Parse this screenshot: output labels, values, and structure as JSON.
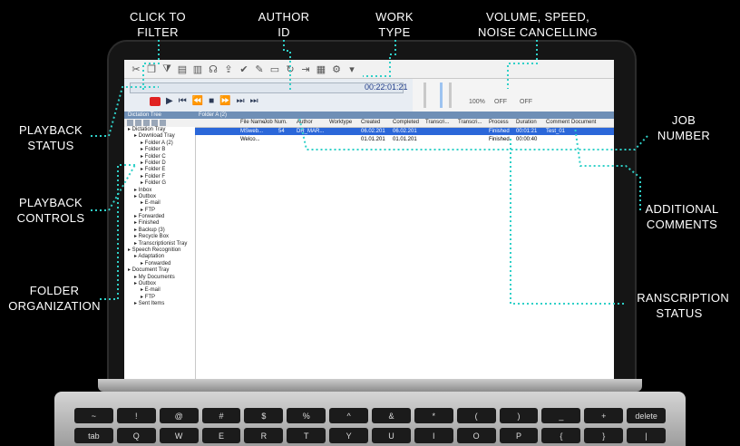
{
  "callouts": {
    "click_to_filter": "CLICK TO\nFILTER",
    "author_id": "AUTHOR\nID",
    "work_type": "WORK\nTYPE",
    "volume_speed": "VOLUME, SPEED,\nNOISE CANCELLING",
    "playback_status": "PLAYBACK\nSTATUS",
    "job_number": "JOB\nNUMBER",
    "playback_controls": "PLAYBACK\nCONTROLS",
    "additional_comments": "ADDITIONAL\nCOMMENTS",
    "folder_organization": "FOLDER\nORGANIZATION",
    "transcription_status": "TRANSCRIPTION\nSTATUS"
  },
  "app": {
    "time_display": "00:22:01:21",
    "tree_header": "Dictation Tree",
    "list_header": "Folder A (2)",
    "settings": {
      "volume_label": "100%",
      "speed_label": "OFF",
      "noise_label": "OFF"
    },
    "tree_items": [
      "Dictation Tray",
      "Download Tray",
      "Folder A (2)",
      "Folder B",
      "Folder C",
      "Folder D",
      "Folder E",
      "Folder F",
      "Folder G",
      "Inbox",
      "Outbox",
      "E-mail",
      "FTP",
      "Forwarded",
      "Finished",
      "Backup (3)",
      "Recycle Box",
      "Transcriptionist Tray",
      "Speech Recognition",
      "Adaptation",
      "Forwarded",
      "Document Tray",
      "My Documents",
      "Outbox",
      "E-mail",
      "FTP",
      "Sent Items"
    ],
    "columns": [
      "File Name",
      "Job Num.",
      "Author",
      "Worktype",
      "Created",
      "Completed",
      "Transcri...",
      "Transcri...",
      "Process",
      "Duration",
      "Comment",
      "Document"
    ],
    "rows": [
      {
        "file": "MSweb...",
        "job": "54",
        "author": "DR_MAR...",
        "created": "06.02.201",
        "completed": "06.02.201",
        "process": "Finished",
        "duration": "00:01:21",
        "comment": "Test_01"
      },
      {
        "file": "Welco...",
        "job": "",
        "author": "",
        "created": "01.01.201",
        "completed": "01.01.201",
        "process": "Finished",
        "duration": "00:00:40",
        "comment": ""
      }
    ]
  },
  "keyboard": {
    "row1": [
      "~",
      "!",
      "@",
      "#",
      "$",
      "%",
      "^",
      "&",
      "*",
      "(",
      ")",
      "_",
      "+",
      "delete"
    ],
    "row2": [
      "tab",
      "Q",
      "W",
      "E",
      "R",
      "T",
      "Y",
      "U",
      "I",
      "O",
      "P",
      "{",
      "}",
      "|"
    ]
  }
}
